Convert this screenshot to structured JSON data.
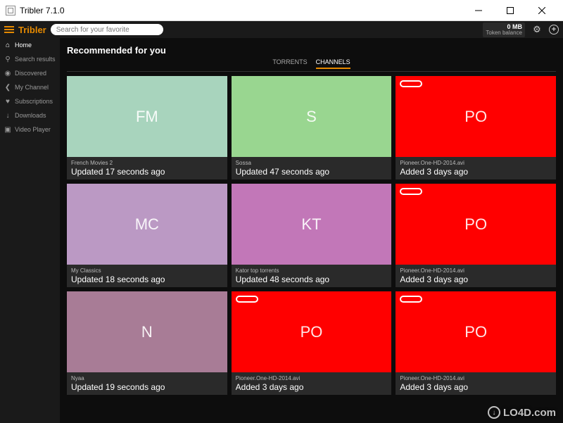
{
  "window": {
    "title": "Tribler 7.1.0"
  },
  "header": {
    "app_name": "Tribler",
    "search_placeholder": "Search for your favorite",
    "token_amount": "0 MB",
    "token_label": "Token balance"
  },
  "sidebar": {
    "items": [
      {
        "icon": "home-icon",
        "glyph": "⌂",
        "label": "Home",
        "active": true
      },
      {
        "icon": "search-icon",
        "glyph": "⚲",
        "label": "Search results",
        "active": false
      },
      {
        "icon": "discovered-icon",
        "glyph": "◉",
        "label": "Discovered",
        "active": false
      },
      {
        "icon": "share-icon",
        "glyph": "❮",
        "label": "My Channel",
        "active": false
      },
      {
        "icon": "heart-icon",
        "glyph": "♥",
        "label": "Subscriptions",
        "active": false
      },
      {
        "icon": "download-icon",
        "glyph": "↓",
        "label": "Downloads",
        "active": false
      },
      {
        "icon": "video-icon",
        "glyph": "▣",
        "label": "Video Player",
        "active": false
      }
    ]
  },
  "content": {
    "title": "Recommended for you",
    "tabs": [
      {
        "label": "TORRENTS",
        "active": false
      },
      {
        "label": "CHANNELS",
        "active": true
      }
    ],
    "cards": [
      {
        "initials": "FM",
        "color": "ltgreen",
        "pill": false,
        "title": "French Movies 2",
        "sub": "Updated 17 seconds ago"
      },
      {
        "initials": "S",
        "color": "green",
        "pill": false,
        "title": "Sossa",
        "sub": "Updated 47 seconds ago"
      },
      {
        "initials": "PO",
        "color": "red",
        "pill": true,
        "title": "Pioneer.One-HD-2014.avi",
        "sub": "Added 3 days ago"
      },
      {
        "initials": "MC",
        "color": "purple1",
        "pill": false,
        "title": "My Classics",
        "sub": "Updated 18 seconds ago"
      },
      {
        "initials": "KT",
        "color": "purple2",
        "pill": false,
        "title": "Kator top torrents",
        "sub": "Updated 48 seconds ago"
      },
      {
        "initials": "PO",
        "color": "red",
        "pill": true,
        "title": "Pioneer.One-HD-2014.avi",
        "sub": "Added 3 days ago"
      },
      {
        "initials": "N",
        "color": "purple3",
        "pill": false,
        "title": "Nyaa",
        "sub": "Updated 19 seconds ago"
      },
      {
        "initials": "PO",
        "color": "red",
        "pill": true,
        "title": "Pioneer.One-HD-2014.avi",
        "sub": "Added 3 days ago"
      },
      {
        "initials": "PO",
        "color": "red",
        "pill": true,
        "title": "Pioneer.One-HD-2014.avi",
        "sub": "Added 3 days ago"
      }
    ]
  },
  "watermark": "LO4D.com"
}
